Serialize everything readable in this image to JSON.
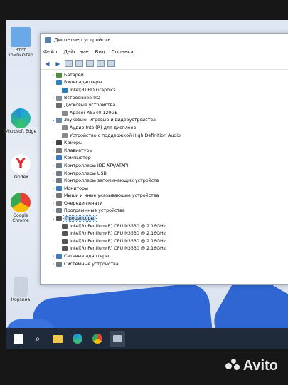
{
  "desktop": {
    "icons": [
      {
        "name": "this-pc",
        "label": "Этот компьютер",
        "color": "#6aa8e8"
      },
      {
        "name": "edge",
        "label": "Microsoft Edge",
        "color": "#1f8fd8"
      },
      {
        "name": "yandex",
        "label": "Yandex",
        "color": "#e3262c"
      },
      {
        "name": "chrome",
        "label": "Google Chrome",
        "color": "#f0b428"
      },
      {
        "name": "recycle-bin",
        "label": "Корзина",
        "color": "#b9c7d6"
      }
    ]
  },
  "window": {
    "title": "Диспетчер устройств",
    "menu": [
      "Файл",
      "Действие",
      "Вид",
      "Справка"
    ]
  },
  "tree": [
    {
      "label": "Батареи",
      "level": 0,
      "expanded": false,
      "icon_color": "#4f8f3a"
    },
    {
      "label": "Видеоадаптеры",
      "level": 0,
      "expanded": true,
      "icon_color": "#2a7fbf"
    },
    {
      "label": "Intel(R) HD Graphics",
      "level": 1,
      "icon_color": "#2a7fbf"
    },
    {
      "label": "Встроенное ПО",
      "level": 0,
      "expanded": false,
      "icon_color": "#7f8c99"
    },
    {
      "label": "Дисковые устройства",
      "level": 0,
      "expanded": true,
      "icon_color": "#6b6b6b"
    },
    {
      "label": "Apacer AS340 120GB",
      "level": 1,
      "icon_color": "#8a8a8a"
    },
    {
      "label": "Звуковые, игровые и видеоустройства",
      "level": 0,
      "expanded": true,
      "icon_color": "#6a8aa8"
    },
    {
      "label": "Аудио Intel(R) для дисплеев",
      "level": 1,
      "icon_color": "#8a8a8a"
    },
    {
      "label": "Устройство с поддержкой High Definition Audio",
      "level": 1,
      "icon_color": "#8a8a8a"
    },
    {
      "label": "Камеры",
      "level": 0,
      "expanded": false,
      "icon_color": "#444"
    },
    {
      "label": "Клавиатуры",
      "level": 0,
      "expanded": false,
      "icon_color": "#777"
    },
    {
      "label": "Компьютер",
      "level": 0,
      "expanded": false,
      "icon_color": "#3b7dc4"
    },
    {
      "label": "Контроллеры IDE ATA/ATAPI",
      "level": 0,
      "expanded": false,
      "icon_color": "#6e7c8a"
    },
    {
      "label": "Контроллеры USB",
      "level": 0,
      "expanded": false,
      "icon_color": "#6e7c8a"
    },
    {
      "label": "Контроллеры запоминающих устройств",
      "level": 0,
      "expanded": false,
      "icon_color": "#6e7c8a"
    },
    {
      "label": "Мониторы",
      "level": 0,
      "expanded": false,
      "icon_color": "#3b7dc4"
    },
    {
      "label": "Мыши и иные указывающие устройства",
      "level": 0,
      "expanded": false,
      "icon_color": "#777"
    },
    {
      "label": "Очереди печати",
      "level": 0,
      "expanded": false,
      "icon_color": "#777"
    },
    {
      "label": "Программные устройства",
      "level": 0,
      "expanded": false,
      "icon_color": "#6e7c8a"
    },
    {
      "label": "Процессоры",
      "level": 0,
      "expanded": true,
      "selected": true,
      "icon_color": "#555"
    },
    {
      "label": "Intel(R) Pentium(R) CPU  N3530  @ 2.16GHz",
      "level": 1,
      "icon_color": "#555"
    },
    {
      "label": "Intel(R) Pentium(R) CPU  N3530  @ 2.16GHz",
      "level": 1,
      "icon_color": "#555"
    },
    {
      "label": "Intel(R) Pentium(R) CPU  N3530  @ 2.16GHz",
      "level": 1,
      "icon_color": "#555"
    },
    {
      "label": "Intel(R) Pentium(R) CPU  N3530  @ 2.16GHz",
      "level": 1,
      "icon_color": "#555"
    },
    {
      "label": "Сетевые адаптеры",
      "level": 0,
      "expanded": false,
      "icon_color": "#3b7dc4"
    },
    {
      "label": "Системные устройства",
      "level": 0,
      "expanded": false,
      "icon_color": "#6e7c8a"
    }
  ],
  "taskbar": [
    "windows-icon",
    "search-icon",
    "file-explorer-icon",
    "edge-icon",
    "chrome-icon",
    "device-manager-icon"
  ],
  "watermark": "Avito"
}
